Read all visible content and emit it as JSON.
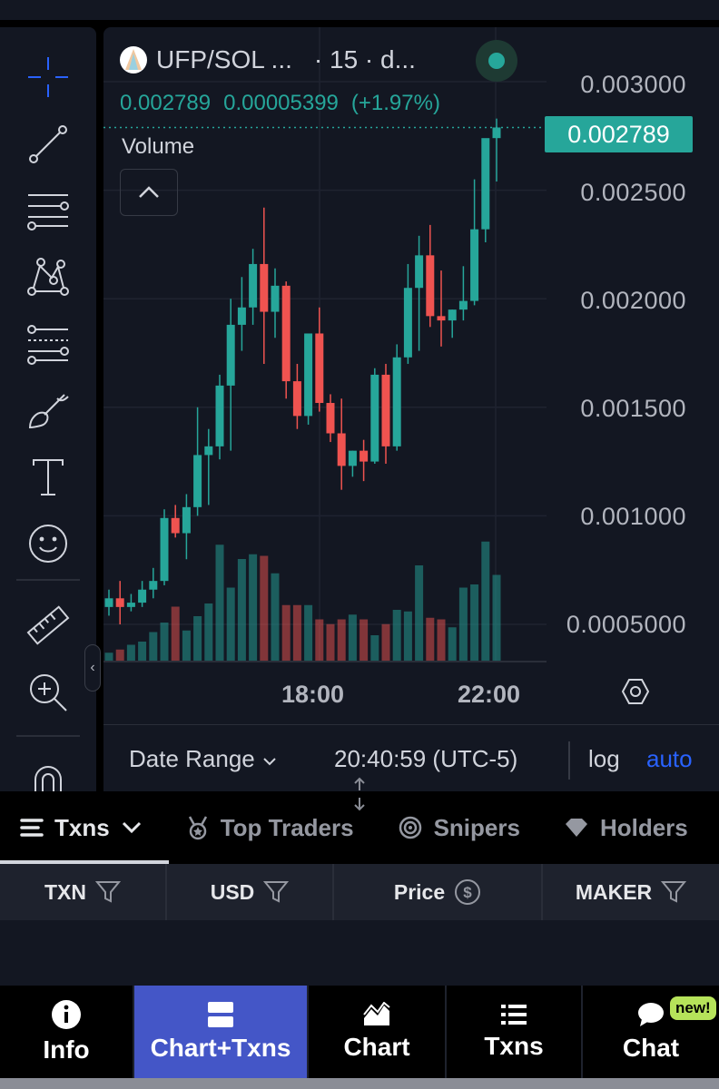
{
  "pair": {
    "symbol": "UFP/SOL ...",
    "interval": "· 15 · d...",
    "last_price": "0.002789",
    "change": "0.00005399",
    "change_pct": "(+1.97%)",
    "volume_label": "Volume"
  },
  "price_axis": [
    "0.003000",
    "0.002500",
    "0.002000",
    "0.001500",
    "0.001000",
    "0.0005000"
  ],
  "time_axis": [
    "18:00",
    "22:00"
  ],
  "bottom_bar": {
    "date_range": "Date Range",
    "clock": "20:40:59 (UTC-5)",
    "log": "log",
    "auto": "auto"
  },
  "tabs": [
    {
      "label": "Txns",
      "icon": "list-icon",
      "active": true
    },
    {
      "label": "Top Traders",
      "icon": "medal-icon",
      "active": false
    },
    {
      "label": "Snipers",
      "icon": "target-icon",
      "active": false
    },
    {
      "label": "Holders",
      "icon": "diamond-icon",
      "active": false
    }
  ],
  "table_columns": [
    "TXN",
    "USD",
    "Price",
    "MAKER"
  ],
  "nav": [
    {
      "label": "Info",
      "icon": "info-icon",
      "active": false
    },
    {
      "label": "Chart+Txns",
      "icon": "split-view-icon",
      "active": true
    },
    {
      "label": "Chart",
      "icon": "chart-icon",
      "active": false
    },
    {
      "label": "Txns",
      "icon": "list-icon",
      "active": false
    },
    {
      "label": "Chat",
      "icon": "chat-icon",
      "active": false,
      "badge": "new!"
    }
  ],
  "colors": {
    "up": "#26a69a",
    "down": "#ef5350",
    "accent": "#4456c7",
    "badge": "#b6e35a"
  },
  "candles": [
    {
      "o": 0.00058,
      "h": 0.00066,
      "l": 0.00054,
      "c": 0.00062,
      "v": 0.05
    },
    {
      "o": 0.00062,
      "h": 0.0007,
      "l": 0.0005,
      "c": 0.00058,
      "v": 0.07
    },
    {
      "o": 0.00058,
      "h": 0.00064,
      "l": 0.00056,
      "c": 0.0006,
      "v": 0.1
    },
    {
      "o": 0.0006,
      "h": 0.0007,
      "l": 0.00058,
      "c": 0.00066,
      "v": 0.12
    },
    {
      "o": 0.00066,
      "h": 0.00076,
      "l": 0.00062,
      "c": 0.0007,
      "v": 0.18
    },
    {
      "o": 0.0007,
      "h": 0.00103,
      "l": 0.00068,
      "c": 0.00099,
      "v": 0.24
    },
    {
      "o": 0.00099,
      "h": 0.00105,
      "l": 0.0009,
      "c": 0.00092,
      "v": 0.34
    },
    {
      "o": 0.00092,
      "h": 0.0011,
      "l": 0.0008,
      "c": 0.00104,
      "v": 0.19
    },
    {
      "o": 0.00104,
      "h": 0.0015,
      "l": 0.001,
      "c": 0.00128,
      "v": 0.28
    },
    {
      "o": 0.00128,
      "h": 0.0014,
      "l": 0.00105,
      "c": 0.00132,
      "v": 0.36
    },
    {
      "o": 0.00132,
      "h": 0.00165,
      "l": 0.00126,
      "c": 0.0016,
      "v": 0.73
    },
    {
      "o": 0.0016,
      "h": 0.002,
      "l": 0.0013,
      "c": 0.00188,
      "v": 0.46
    },
    {
      "o": 0.00188,
      "h": 0.0021,
      "l": 0.00176,
      "c": 0.00196,
      "v": 0.64
    },
    {
      "o": 0.00196,
      "h": 0.00223,
      "l": 0.00188,
      "c": 0.00216,
      "v": 0.67
    },
    {
      "o": 0.00216,
      "h": 0.00242,
      "l": 0.0017,
      "c": 0.00194,
      "v": 0.66
    },
    {
      "o": 0.00194,
      "h": 0.00214,
      "l": 0.00182,
      "c": 0.00206,
      "v": 0.55
    },
    {
      "o": 0.00206,
      "h": 0.00208,
      "l": 0.00154,
      "c": 0.00162,
      "v": 0.35
    },
    {
      "o": 0.00162,
      "h": 0.0017,
      "l": 0.0014,
      "c": 0.00146,
      "v": 0.35
    },
    {
      "o": 0.00146,
      "h": 0.0018,
      "l": 0.00142,
      "c": 0.00184,
      "v": 0.35
    },
    {
      "o": 0.00184,
      "h": 0.00196,
      "l": 0.00148,
      "c": 0.00152,
      "v": 0.26
    },
    {
      "o": 0.00152,
      "h": 0.00156,
      "l": 0.00134,
      "c": 0.00138,
      "v": 0.23
    },
    {
      "o": 0.00138,
      "h": 0.00154,
      "l": 0.00112,
      "c": 0.00123,
      "v": 0.26
    },
    {
      "o": 0.00123,
      "h": 0.0013,
      "l": 0.00118,
      "c": 0.0013,
      "v": 0.29
    },
    {
      "o": 0.0013,
      "h": 0.00135,
      "l": 0.00116,
      "c": 0.00125,
      "v": 0.26
    },
    {
      "o": 0.00125,
      "h": 0.00168,
      "l": 0.00124,
      "c": 0.00165,
      "v": 0.16
    },
    {
      "o": 0.00165,
      "h": 0.0017,
      "l": 0.00124,
      "c": 0.00132,
      "v": 0.23
    },
    {
      "o": 0.00132,
      "h": 0.00179,
      "l": 0.0013,
      "c": 0.00173,
      "v": 0.32
    },
    {
      "o": 0.00173,
      "h": 0.00216,
      "l": 0.0017,
      "c": 0.00205,
      "v": 0.31
    },
    {
      "o": 0.00205,
      "h": 0.00229,
      "l": 0.00176,
      "c": 0.0022,
      "v": 0.6
    },
    {
      "o": 0.0022,
      "h": 0.00234,
      "l": 0.00187,
      "c": 0.00192,
      "v": 0.27
    },
    {
      "o": 0.00192,
      "h": 0.00213,
      "l": 0.00178,
      "c": 0.0019,
      "v": 0.26
    },
    {
      "o": 0.0019,
      "h": 0.00195,
      "l": 0.00182,
      "c": 0.00195,
      "v": 0.21
    },
    {
      "o": 0.00195,
      "h": 0.00215,
      "l": 0.0019,
      "c": 0.00199,
      "v": 0.46
    },
    {
      "o": 0.00199,
      "h": 0.00255,
      "l": 0.00197,
      "c": 0.00232,
      "v": 0.48
    },
    {
      "o": 0.00232,
      "h": 0.00272,
      "l": 0.00226,
      "c": 0.00274,
      "v": 0.75
    },
    {
      "o": 0.00274,
      "h": 0.00283,
      "l": 0.00254,
      "c": 0.002789,
      "v": 0.54
    }
  ]
}
